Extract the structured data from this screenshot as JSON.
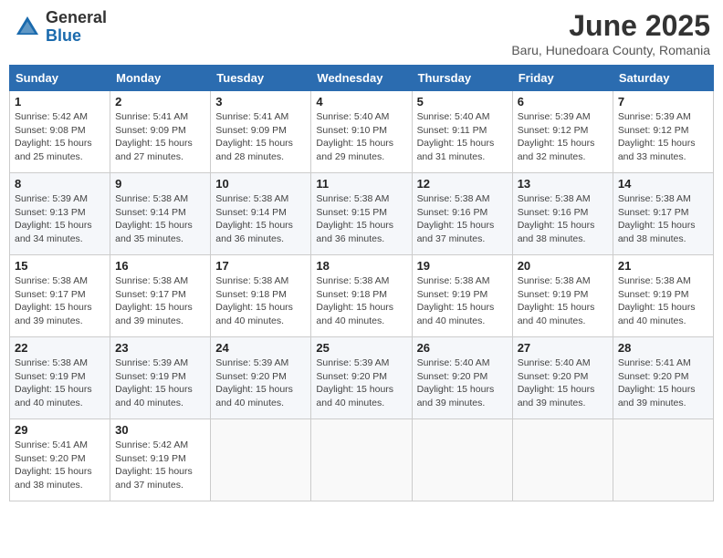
{
  "header": {
    "logo_general": "General",
    "logo_blue": "Blue",
    "month_year": "June 2025",
    "location": "Baru, Hunedoara County, Romania"
  },
  "weekdays": [
    "Sunday",
    "Monday",
    "Tuesday",
    "Wednesday",
    "Thursday",
    "Friday",
    "Saturday"
  ],
  "weeks": [
    [
      {
        "day": "1",
        "info": "Sunrise: 5:42 AM\nSunset: 9:08 PM\nDaylight: 15 hours\nand 25 minutes."
      },
      {
        "day": "2",
        "info": "Sunrise: 5:41 AM\nSunset: 9:09 PM\nDaylight: 15 hours\nand 27 minutes."
      },
      {
        "day": "3",
        "info": "Sunrise: 5:41 AM\nSunset: 9:09 PM\nDaylight: 15 hours\nand 28 minutes."
      },
      {
        "day": "4",
        "info": "Sunrise: 5:40 AM\nSunset: 9:10 PM\nDaylight: 15 hours\nand 29 minutes."
      },
      {
        "day": "5",
        "info": "Sunrise: 5:40 AM\nSunset: 9:11 PM\nDaylight: 15 hours\nand 31 minutes."
      },
      {
        "day": "6",
        "info": "Sunrise: 5:39 AM\nSunset: 9:12 PM\nDaylight: 15 hours\nand 32 minutes."
      },
      {
        "day": "7",
        "info": "Sunrise: 5:39 AM\nSunset: 9:12 PM\nDaylight: 15 hours\nand 33 minutes."
      }
    ],
    [
      {
        "day": "8",
        "info": "Sunrise: 5:39 AM\nSunset: 9:13 PM\nDaylight: 15 hours\nand 34 minutes."
      },
      {
        "day": "9",
        "info": "Sunrise: 5:38 AM\nSunset: 9:14 PM\nDaylight: 15 hours\nand 35 minutes."
      },
      {
        "day": "10",
        "info": "Sunrise: 5:38 AM\nSunset: 9:14 PM\nDaylight: 15 hours\nand 36 minutes."
      },
      {
        "day": "11",
        "info": "Sunrise: 5:38 AM\nSunset: 9:15 PM\nDaylight: 15 hours\nand 36 minutes."
      },
      {
        "day": "12",
        "info": "Sunrise: 5:38 AM\nSunset: 9:16 PM\nDaylight: 15 hours\nand 37 minutes."
      },
      {
        "day": "13",
        "info": "Sunrise: 5:38 AM\nSunset: 9:16 PM\nDaylight: 15 hours\nand 38 minutes."
      },
      {
        "day": "14",
        "info": "Sunrise: 5:38 AM\nSunset: 9:17 PM\nDaylight: 15 hours\nand 38 minutes."
      }
    ],
    [
      {
        "day": "15",
        "info": "Sunrise: 5:38 AM\nSunset: 9:17 PM\nDaylight: 15 hours\nand 39 minutes."
      },
      {
        "day": "16",
        "info": "Sunrise: 5:38 AM\nSunset: 9:17 PM\nDaylight: 15 hours\nand 39 minutes."
      },
      {
        "day": "17",
        "info": "Sunrise: 5:38 AM\nSunset: 9:18 PM\nDaylight: 15 hours\nand 40 minutes."
      },
      {
        "day": "18",
        "info": "Sunrise: 5:38 AM\nSunset: 9:18 PM\nDaylight: 15 hours\nand 40 minutes."
      },
      {
        "day": "19",
        "info": "Sunrise: 5:38 AM\nSunset: 9:19 PM\nDaylight: 15 hours\nand 40 minutes."
      },
      {
        "day": "20",
        "info": "Sunrise: 5:38 AM\nSunset: 9:19 PM\nDaylight: 15 hours\nand 40 minutes."
      },
      {
        "day": "21",
        "info": "Sunrise: 5:38 AM\nSunset: 9:19 PM\nDaylight: 15 hours\nand 40 minutes."
      }
    ],
    [
      {
        "day": "22",
        "info": "Sunrise: 5:38 AM\nSunset: 9:19 PM\nDaylight: 15 hours\nand 40 minutes."
      },
      {
        "day": "23",
        "info": "Sunrise: 5:39 AM\nSunset: 9:19 PM\nDaylight: 15 hours\nand 40 minutes."
      },
      {
        "day": "24",
        "info": "Sunrise: 5:39 AM\nSunset: 9:20 PM\nDaylight: 15 hours\nand 40 minutes."
      },
      {
        "day": "25",
        "info": "Sunrise: 5:39 AM\nSunset: 9:20 PM\nDaylight: 15 hours\nand 40 minutes."
      },
      {
        "day": "26",
        "info": "Sunrise: 5:40 AM\nSunset: 9:20 PM\nDaylight: 15 hours\nand 39 minutes."
      },
      {
        "day": "27",
        "info": "Sunrise: 5:40 AM\nSunset: 9:20 PM\nDaylight: 15 hours\nand 39 minutes."
      },
      {
        "day": "28",
        "info": "Sunrise: 5:41 AM\nSunset: 9:20 PM\nDaylight: 15 hours\nand 39 minutes."
      }
    ],
    [
      {
        "day": "29",
        "info": "Sunrise: 5:41 AM\nSunset: 9:20 PM\nDaylight: 15 hours\nand 38 minutes."
      },
      {
        "day": "30",
        "info": "Sunrise: 5:42 AM\nSunset: 9:19 PM\nDaylight: 15 hours\nand 37 minutes."
      },
      null,
      null,
      null,
      null,
      null
    ]
  ]
}
